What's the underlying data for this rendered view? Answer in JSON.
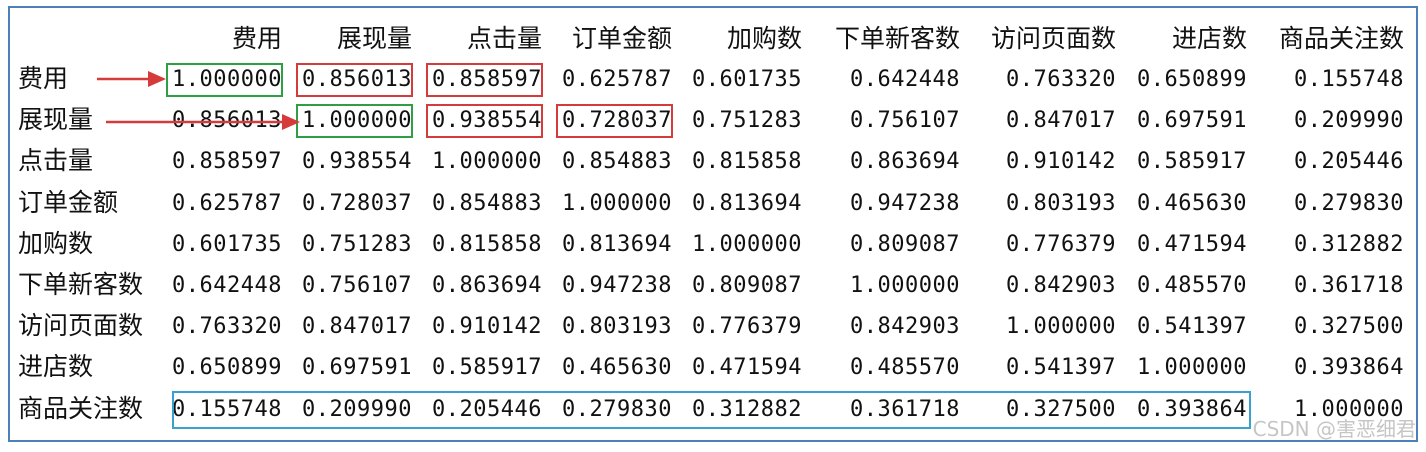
{
  "table": {
    "columns": [
      "费用",
      "展现量",
      "点击量",
      "订单金额",
      "加购数",
      "下单新客数",
      "访问页面数",
      "进店数",
      "商品关注数"
    ],
    "rows": [
      {
        "label": "费用",
        "values": [
          "1.000000",
          "0.856013",
          "0.858597",
          "0.625787",
          "0.601735",
          "0.642448",
          "0.763320",
          "0.650899",
          "0.155748"
        ]
      },
      {
        "label": "展现量",
        "values": [
          "0.856013",
          "1.000000",
          "0.938554",
          "0.728037",
          "0.751283",
          "0.756107",
          "0.847017",
          "0.697591",
          "0.209990"
        ]
      },
      {
        "label": "点击量",
        "values": [
          "0.858597",
          "0.938554",
          "1.000000",
          "0.854883",
          "0.815858",
          "0.863694",
          "0.910142",
          "0.585917",
          "0.205446"
        ]
      },
      {
        "label": "订单金额",
        "values": [
          "0.625787",
          "0.728037",
          "0.854883",
          "1.000000",
          "0.813694",
          "0.947238",
          "0.803193",
          "0.465630",
          "0.279830"
        ]
      },
      {
        "label": "加购数",
        "values": [
          "0.601735",
          "0.751283",
          "0.815858",
          "0.813694",
          "1.000000",
          "0.809087",
          "0.776379",
          "0.471594",
          "0.312882"
        ]
      },
      {
        "label": "下单新客数",
        "values": [
          "0.642448",
          "0.756107",
          "0.863694",
          "0.947238",
          "0.809087",
          "1.000000",
          "0.842903",
          "0.485570",
          "0.361718"
        ]
      },
      {
        "label": "访问页面数",
        "values": [
          "0.763320",
          "0.847017",
          "0.910142",
          "0.803193",
          "0.776379",
          "0.842903",
          "1.000000",
          "0.541397",
          "0.327500"
        ]
      },
      {
        "label": "进店数",
        "values": [
          "0.650899",
          "0.697591",
          "0.585917",
          "0.465630",
          "0.471594",
          "0.485570",
          "0.541397",
          "1.000000",
          "0.393864"
        ]
      },
      {
        "label": "商品关注数",
        "values": [
          "0.155748",
          "0.209990",
          "0.205446",
          "0.279830",
          "0.312882",
          "0.361718",
          "0.327500",
          "0.393864",
          "1.000000"
        ]
      }
    ]
  },
  "highlights": {
    "green": {
      "color": "#2ea043",
      "cells": [
        [
          0,
          0
        ],
        [
          1,
          1
        ]
      ]
    },
    "red": {
      "color": "#d63b3b",
      "cells": [
        [
          0,
          1
        ],
        [
          0,
          2
        ],
        [
          1,
          2
        ],
        [
          1,
          3
        ]
      ]
    },
    "blue": {
      "color": "#3aa0d0",
      "row": 8,
      "from_col": 0,
      "to_col": 7
    },
    "arrows_color": "#d63b3b"
  },
  "watermark": "CSDN @害恶细君"
}
